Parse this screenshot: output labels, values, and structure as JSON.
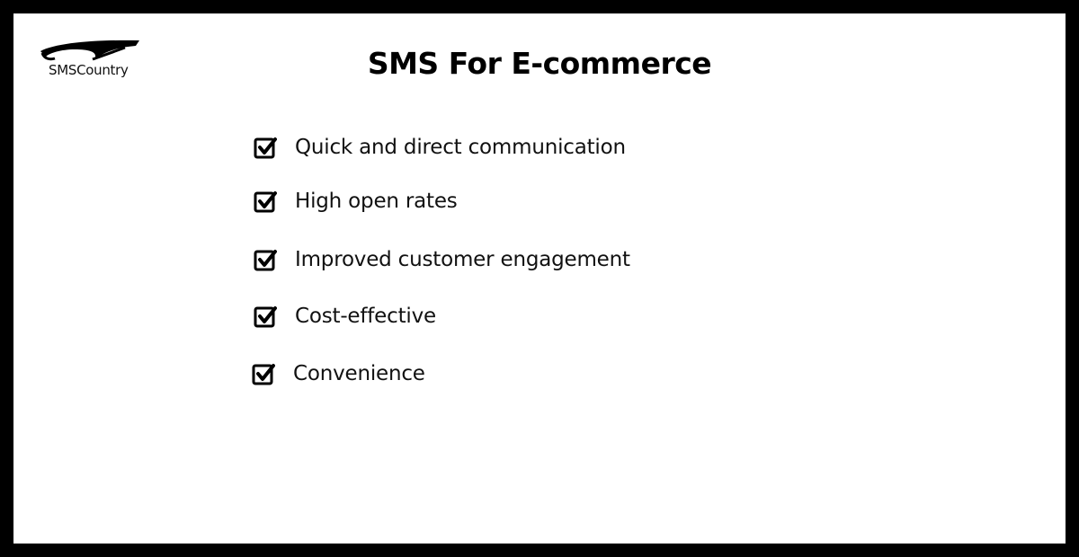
{
  "brand": {
    "logo_text": "SMSCountry",
    "logo_icon": "swoosh-logo-icon"
  },
  "title": "SMS For E-commerce",
  "benefits": [
    {
      "label": "Quick and direct communication",
      "icon": "checkbox-checked-icon"
    },
    {
      "label": "High open rates",
      "icon": "checkbox-checked-icon"
    },
    {
      "label": "Improved customer engagement",
      "icon": "checkbox-checked-icon"
    },
    {
      "label": "Cost-effective",
      "icon": "checkbox-checked-icon"
    },
    {
      "label": "Convenience",
      "icon": "checkbox-checked-icon"
    }
  ],
  "colors": {
    "frame": "#000000",
    "background": "#ffffff",
    "text": "#111111"
  }
}
